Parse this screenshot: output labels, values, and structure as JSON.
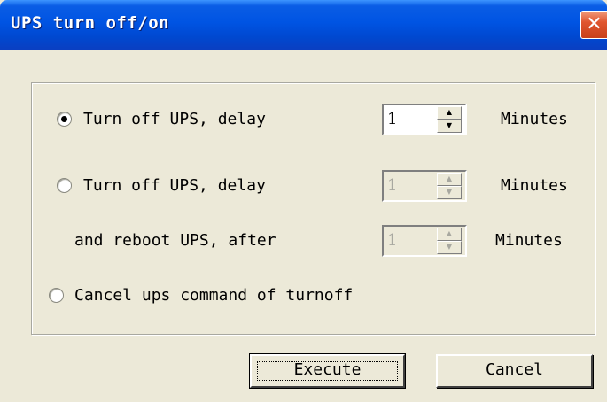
{
  "window": {
    "title": "UPS turn off/on",
    "close_glyph": "✕"
  },
  "options": [
    {
      "label": "Turn off UPS, delay",
      "selected": true,
      "spinner": {
        "value": "1",
        "enabled": true
      },
      "unit": "Minutes"
    },
    {
      "label": "Turn off UPS, delay",
      "selected": false,
      "spinner": {
        "value": "1",
        "enabled": false
      },
      "unit": "Minutes",
      "sub": {
        "label": "and reboot UPS, after",
        "spinner": {
          "value": "1",
          "enabled": false
        },
        "unit": "Minutes"
      }
    },
    {
      "label": "Cancel ups command of turnoff",
      "selected": false
    }
  ],
  "buttons": {
    "execute": "Execute",
    "cancel": "Cancel"
  },
  "colors": {
    "title_bar": "#0054e3",
    "dialog_bg": "#ece9d8",
    "close_button": "#e0562f"
  },
  "icons": {
    "close": "close-icon",
    "spin_up": "arrow-up-icon",
    "spin_down": "arrow-down-icon"
  }
}
